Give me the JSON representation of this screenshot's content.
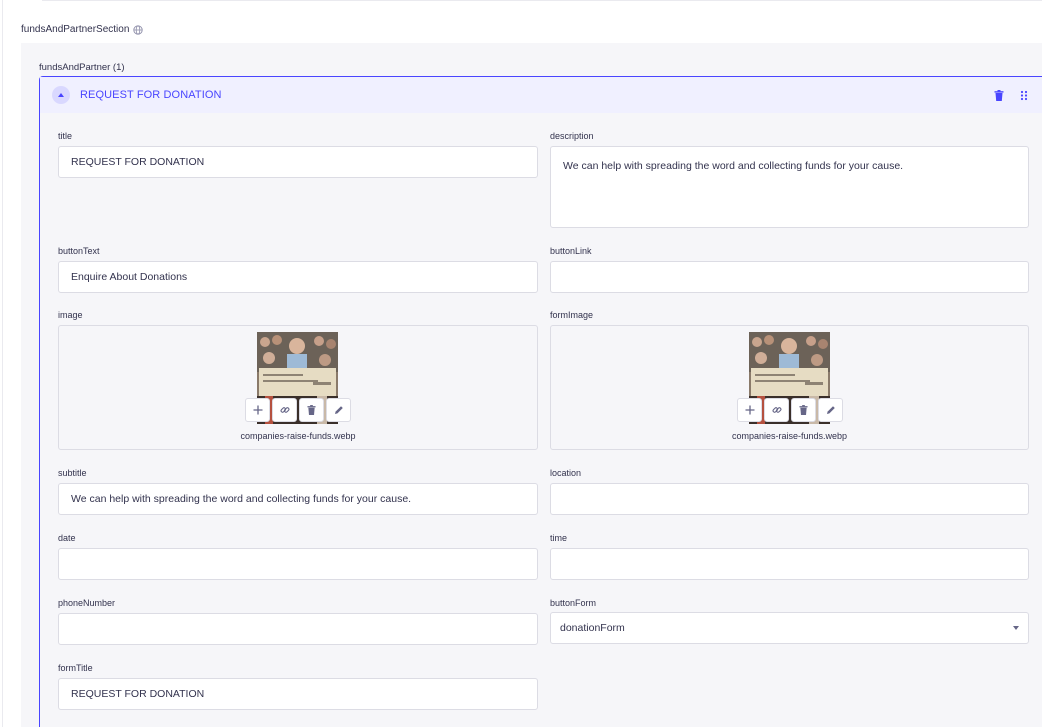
{
  "section": {
    "label": "fundsAndPartnerSection"
  },
  "component": {
    "label": "fundsAndPartner (1)",
    "entry_title": "REQUEST FOR DONATION"
  },
  "fields": {
    "title": {
      "label": "title",
      "value": "REQUEST FOR DONATION"
    },
    "description": {
      "label": "description",
      "value": "We can help with spreading the word and collecting funds for your cause."
    },
    "buttonText": {
      "label": "buttonText",
      "value": "Enquire About Donations"
    },
    "buttonLink": {
      "label": "buttonLink",
      "value": ""
    },
    "image": {
      "label": "image",
      "filename": "companies-raise-funds.webp"
    },
    "formImage": {
      "label": "formImage",
      "filename": "companies-raise-funds.webp"
    },
    "subtitle": {
      "label": "subtitle",
      "value": "We can help with spreading the word and collecting funds for your cause."
    },
    "location": {
      "label": "location",
      "value": ""
    },
    "date": {
      "label": "date",
      "value": ""
    },
    "time": {
      "label": "time",
      "value": ""
    },
    "phoneNumber": {
      "label": "phoneNumber",
      "value": ""
    },
    "buttonForm": {
      "label": "buttonForm",
      "value": "donationForm"
    },
    "formTitle": {
      "label": "formTitle",
      "value": "REQUEST FOR DONATION"
    }
  },
  "icons": {
    "collapse": "chevron-up-icon",
    "delete": "trash-icon",
    "drag": "drag-icon",
    "globe": "globe-icon",
    "media_add": "plus-icon",
    "media_link": "link-icon",
    "media_delete": "trash-icon",
    "media_edit": "pencil-icon",
    "select": "caret-down-icon"
  },
  "colors": {
    "accent": "#4945ff",
    "header_bg": "#f0f0ff",
    "panel_bg": "#f6f6f9",
    "border": "#dcdce4",
    "text": "#32324d"
  }
}
